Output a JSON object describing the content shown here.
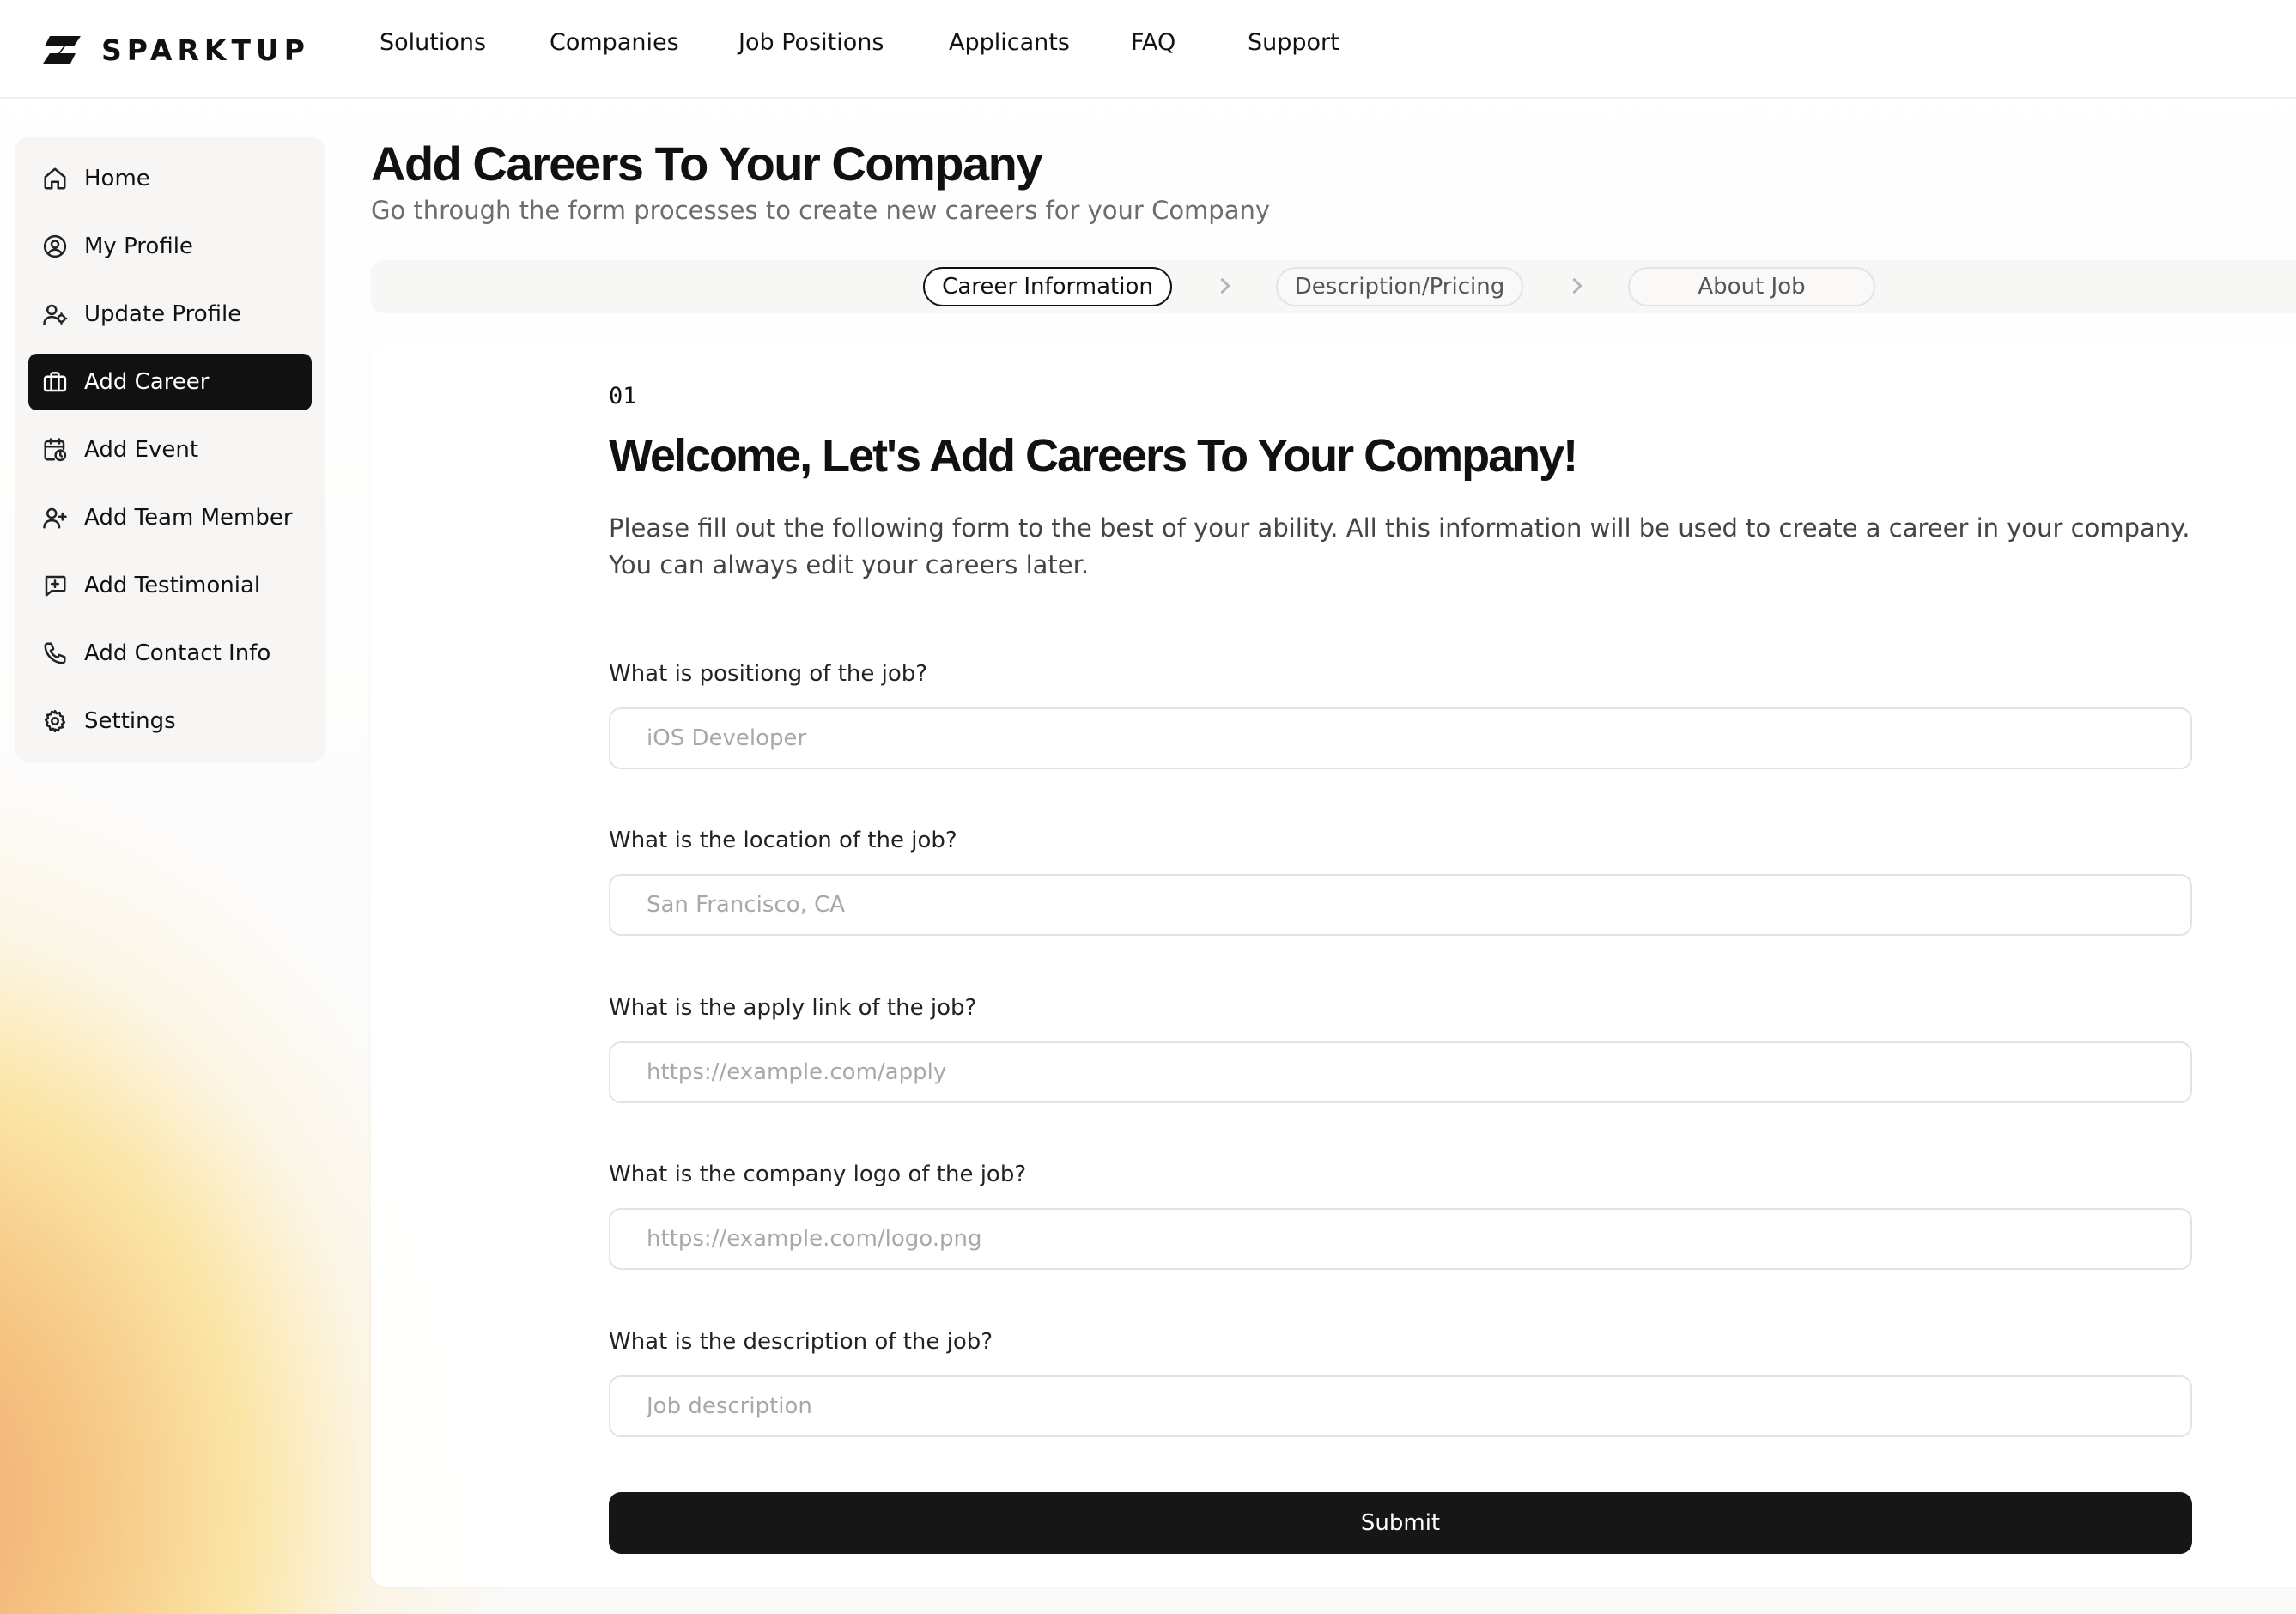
{
  "brand": {
    "name": "SPARKTUP",
    "logo_icon": "sparktup-logo-icon"
  },
  "topnav": {
    "links": [
      "Solutions",
      "Companies",
      "Job Positions",
      "Applicants",
      "FAQ",
      "Support"
    ]
  },
  "sidebar": {
    "active_index": 3,
    "items": [
      {
        "label": "Home",
        "icon": "home-icon"
      },
      {
        "label": "My Profile",
        "icon": "user-circle-icon"
      },
      {
        "label": "Update Profile",
        "icon": "user-edit-icon"
      },
      {
        "label": "Add Career",
        "icon": "briefcase-icon"
      },
      {
        "label": "Add Event",
        "icon": "calendar-clock-icon"
      },
      {
        "label": "Add Team Member",
        "icon": "user-plus-icon"
      },
      {
        "label": "Add Testimonial",
        "icon": "message-plus-icon"
      },
      {
        "label": "Add Contact Info",
        "icon": "phone-icon"
      },
      {
        "label": "Settings",
        "icon": "gear-icon"
      }
    ]
  },
  "header": {
    "title": "Add Careers To Your Company",
    "subtitle": "Go through the form processes to create new careers for your Company"
  },
  "stepper": {
    "steps": [
      "Career Information",
      "Description/Pricing",
      "About Job"
    ],
    "active_index": 0
  },
  "form": {
    "step_number": "01",
    "heading": "Welcome, Let's Add Careers To Your Company!",
    "intro": "Please fill out the following form to the best of your ability. All this information will be used to create a career in your company. You can always edit your careers later.",
    "fields": [
      {
        "label": "What is positiong of the job?",
        "placeholder": "iOS Developer",
        "value": ""
      },
      {
        "label": "What is the location of the job?",
        "placeholder": "San Francisco, CA",
        "value": ""
      },
      {
        "label": "What is the apply link of the job?",
        "placeholder": "https://example.com/apply",
        "value": ""
      },
      {
        "label": "What is the company logo of the job?",
        "placeholder": "https://example.com/logo.png",
        "value": ""
      },
      {
        "label": "What is the description of the job?",
        "placeholder": "Job description",
        "value": ""
      }
    ],
    "submit_label": "Submit"
  },
  "colors": {
    "accent": "#111111",
    "page_gradient_warm": "#f6c684"
  }
}
